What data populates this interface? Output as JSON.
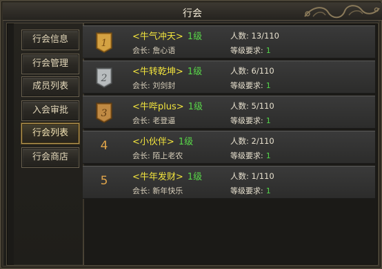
{
  "window": {
    "title": "行会"
  },
  "sidebar": {
    "items": [
      {
        "label": "行会信息",
        "active": false
      },
      {
        "label": "行会管理",
        "active": false
      },
      {
        "label": "成员列表",
        "active": false
      },
      {
        "label": "入会审批",
        "active": false
      },
      {
        "label": "行会列表",
        "active": true
      },
      {
        "label": "行会商店",
        "active": false
      }
    ]
  },
  "guilds": [
    {
      "rank": "1",
      "badge": "gold-badge",
      "name": "<牛气冲天>",
      "level": "1级",
      "leader_label": "会长:",
      "leader": "詹心语",
      "members_label": "人数:",
      "members": "13/110",
      "req_label": "等级要求:",
      "req": "1"
    },
    {
      "rank": "2",
      "badge": "silver-badge",
      "name": "<牛转乾坤>",
      "level": "1级",
      "leader_label": "会长:",
      "leader": "刘剑封",
      "members_label": "人数:",
      "members": "6/110",
      "req_label": "等级要求:",
      "req": "1"
    },
    {
      "rank": "3",
      "badge": "bronze-badge",
      "name": "<牛哔plus>",
      "level": "1级",
      "leader_label": "会长:",
      "leader": "老登逼",
      "members_label": "人数:",
      "members": "5/110",
      "req_label": "等级要求:",
      "req": "1"
    },
    {
      "rank": "4",
      "badge": "",
      "name": "<小伙伴>",
      "level": "1级",
      "leader_label": "会长:",
      "leader": "陌上老农",
      "members_label": "人数:",
      "members": "2/110",
      "req_label": "等级要求:",
      "req": "1"
    },
    {
      "rank": "5",
      "badge": "",
      "name": "<牛年发财>",
      "level": "1级",
      "leader_label": "会长:",
      "leader": "新年快乐",
      "members_label": "人数:",
      "members": "1/110",
      "req_label": "等级要求:",
      "req": "1"
    }
  ],
  "colors": {
    "guild_name": "#f3e53d",
    "level": "#59d849",
    "rank_number": "#e2a64a",
    "active_border": "#b79a55"
  }
}
